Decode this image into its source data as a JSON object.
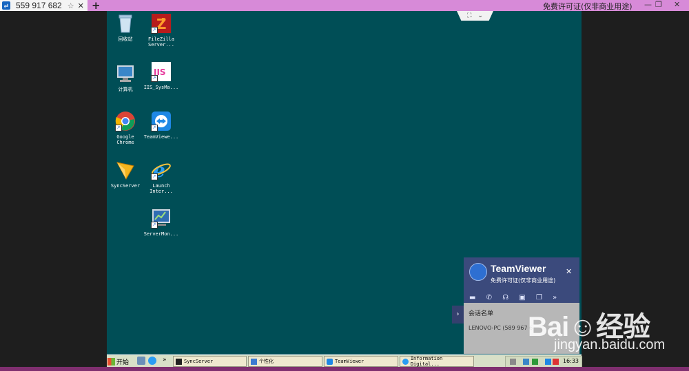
{
  "window": {
    "tab_title": "559 917 682",
    "new_tab": "+",
    "license_text": "免费许可证(仅非商业用途)",
    "controls": [
      "—",
      "❐",
      "✕"
    ]
  },
  "desktop_icons": [
    {
      "label": "回收站",
      "icon": "recycle-bin-icon"
    },
    {
      "label": "FileZilla\nServer...",
      "icon": "filezilla-icon"
    },
    {
      "label": "计算机",
      "icon": "computer-icon"
    },
    {
      "label": "IIS_SysMa...",
      "icon": "iis-icon"
    },
    {
      "label": "Google\nChrome",
      "icon": "chrome-icon"
    },
    {
      "label": "TeamViewe...",
      "icon": "teamviewer-icon"
    },
    {
      "label": "SyncServer",
      "icon": "syncserver-icon"
    },
    {
      "label": "Launch\nInter...",
      "icon": "ie-icon"
    },
    {
      "label": "ServerMon...",
      "icon": "servermon-icon"
    }
  ],
  "taskbar": {
    "start_label": "开始",
    "chevron": "»",
    "tasks": [
      "SyncServer",
      "个性化",
      "TeamViewer",
      "Information Digital..."
    ],
    "clock": "16:33"
  },
  "teamviewer_popup": {
    "name": "TeamViewer",
    "subtitle": "免费许可证(仅非商业用途)",
    "close": "✕",
    "tools": [
      "▬",
      "✆",
      "☊",
      "▣",
      "❐",
      "»"
    ],
    "list_title": "会话名单",
    "partner": "LENOVO-PC (589 967 6",
    "expand": "›"
  },
  "watermark": {
    "brand": "Bai☺经验",
    "url": "jingyan.baidu.com"
  }
}
